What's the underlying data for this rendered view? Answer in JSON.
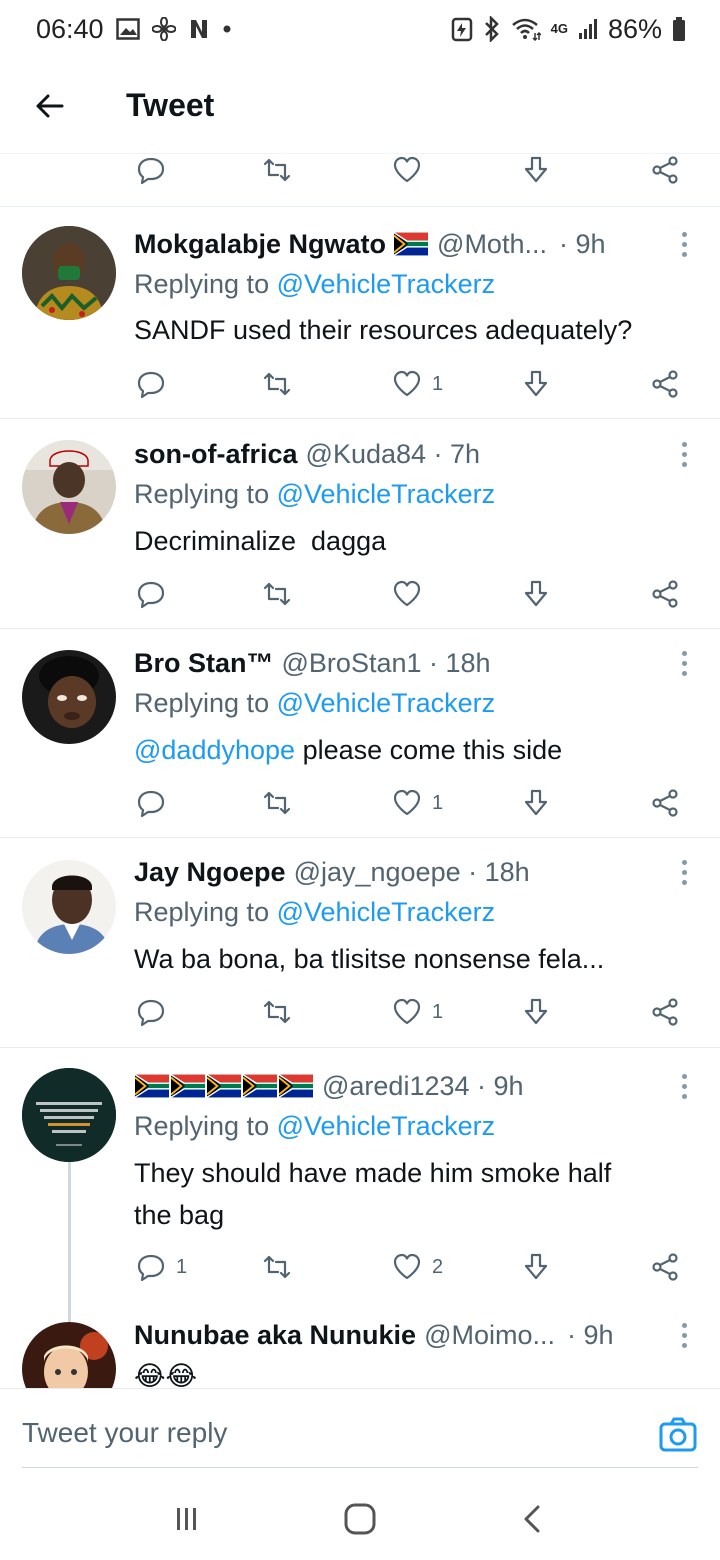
{
  "status_bar": {
    "time": "06:40",
    "network": "4G",
    "battery": "86%"
  },
  "header": {
    "title": "Tweet"
  },
  "tweets": [
    {
      "name": "Mokgalabje Ngwato",
      "handle": "@Moth...",
      "time": "· 9h",
      "replying_prefix": "Replying to",
      "replying_to": "@VehicleTrackerz",
      "text": "SANDF used their resources adequately?",
      "likes": "1"
    },
    {
      "name": "son-of-africa",
      "handle": "@Kuda84 · 7h",
      "replying_prefix": "Replying to",
      "replying_to": "@VehicleTrackerz",
      "text": "Decriminalize  dagga",
      "likes": ""
    },
    {
      "name": "Bro Stan™",
      "handle": "@BroStan1 · 18h",
      "replying_prefix": "Replying to",
      "replying_to": "@VehicleTrackerz",
      "mention": "@daddyhope",
      "text": "please come this side",
      "likes": "1"
    },
    {
      "name": "Jay Ngoepe",
      "handle": "@jay_ngoepe · 18h",
      "replying_prefix": "Replying to",
      "replying_to": "@VehicleTrackerz",
      "text": "Wa ba bona, ba tlisitse nonsense fela...",
      "likes": "1"
    },
    {
      "handle": "@aredi1234 · 9h",
      "replying_prefix": "Replying to",
      "replying_to": "@VehicleTrackerz",
      "text_line1": "They should have made him smoke half",
      "text_line2": "the bag",
      "replies": "1",
      "likes": "2",
      "avatar_text": "In Japan a corrupt person kills himself. In China, they will kill him. In Europe they jail him. In Africa, he will present himself for election."
    },
    {
      "name": "Nunubae aka Nunukie",
      "handle": "@Moimo...",
      "time": "· 9h",
      "text": "😂😂"
    }
  ],
  "composer": {
    "placeholder": "Tweet your reply"
  },
  "colors": {
    "accent": "#1d9bf0",
    "secondary_text": "#536471",
    "divider": "#e6ecf0"
  }
}
